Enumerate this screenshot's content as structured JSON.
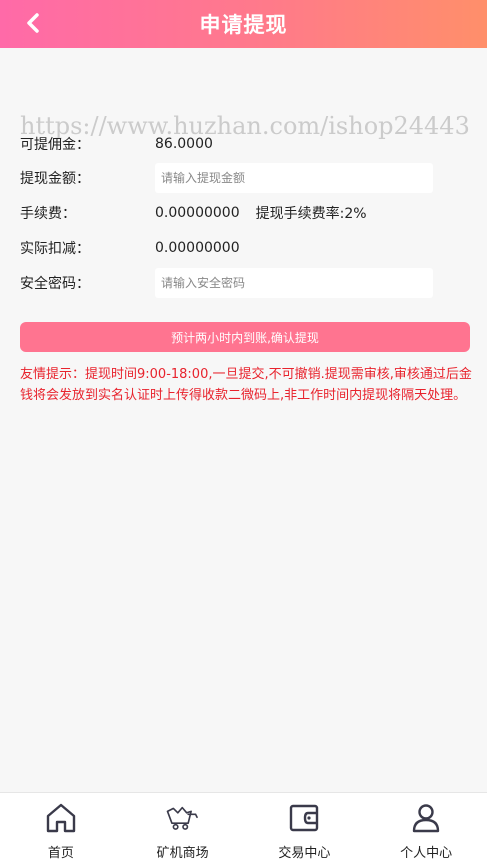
{
  "header": {
    "title": "申请提现",
    "back_icon": "chevron-left-icon"
  },
  "watermark": "https://www.huzhan.com/ishop24443",
  "form": {
    "commission": {
      "label": "可提佣金：",
      "value": "86.0000"
    },
    "amount": {
      "label": "提现金额：",
      "placeholder": "请输入提现金额"
    },
    "fee": {
      "label": "手续费：",
      "value": "0.00000000",
      "rate_text": "提现手续费率:2%"
    },
    "deduction": {
      "label": "实际扣减：",
      "value": "0.00000000"
    },
    "password": {
      "label": "安全密码：",
      "placeholder": "请输入安全密码"
    }
  },
  "submit_label": "预计两小时内到账,确认提现",
  "notice": "友情提示：提现时间9:00-18:00,一旦提交,不可撤销.提现需审核,审核通过后金钱将会发放到实名认证时上传得收款二微码上,非工作时间内提现将隔天处理。",
  "tabbar": [
    {
      "label": "首页",
      "icon": "home-icon"
    },
    {
      "label": "矿机商场",
      "icon": "mining-cart-icon"
    },
    {
      "label": "交易中心",
      "icon": "wallet-icon"
    },
    {
      "label": "个人中心",
      "icon": "user-icon"
    }
  ],
  "colors": {
    "header_gradient_start": "#ff6aa8",
    "header_gradient_end": "#ff8f6a",
    "button": "#ff7490",
    "notice_text": "#e8232d",
    "background": "#f7f7f7"
  }
}
